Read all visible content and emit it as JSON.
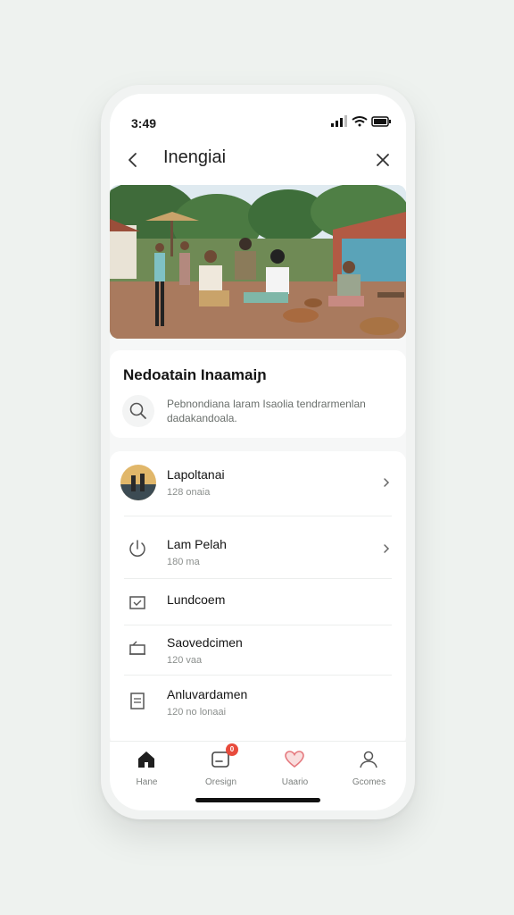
{
  "status": {
    "time": "3:49"
  },
  "nav": {
    "title": "Inengiai"
  },
  "section": {
    "title": "Nedoatain Inaamaiɲ",
    "search_text": "Pebnondiana laram Isaolia tendrarmenlan dadakandoala."
  },
  "list": [
    {
      "title": "Lapoltanai",
      "sub": "128 onaia",
      "icon": "avatar-thumbnail"
    },
    {
      "title": "Lam Pelah",
      "sub": "180 ma",
      "icon": "power-icon"
    },
    {
      "title": "Lundcoem",
      "sub": "",
      "icon": "check-box-icon"
    },
    {
      "title": "Saovedcimen",
      "sub": "120 vaa",
      "icon": "laptop-icon"
    },
    {
      "title": "Anluvardamen",
      "sub": "120 no lonaai",
      "icon": "document-icon"
    }
  ],
  "tabs": [
    {
      "label": "Hane",
      "icon": "home-icon"
    },
    {
      "label": "Oresign",
      "icon": "inbox-icon",
      "badge": "0"
    },
    {
      "label": "Uaario",
      "icon": "heart-icon"
    },
    {
      "label": "Gcomes",
      "icon": "profile-icon"
    }
  ],
  "colors": {
    "accent_red": "#e84b3c",
    "heart": "#e5797e",
    "text_dark": "#151515"
  }
}
